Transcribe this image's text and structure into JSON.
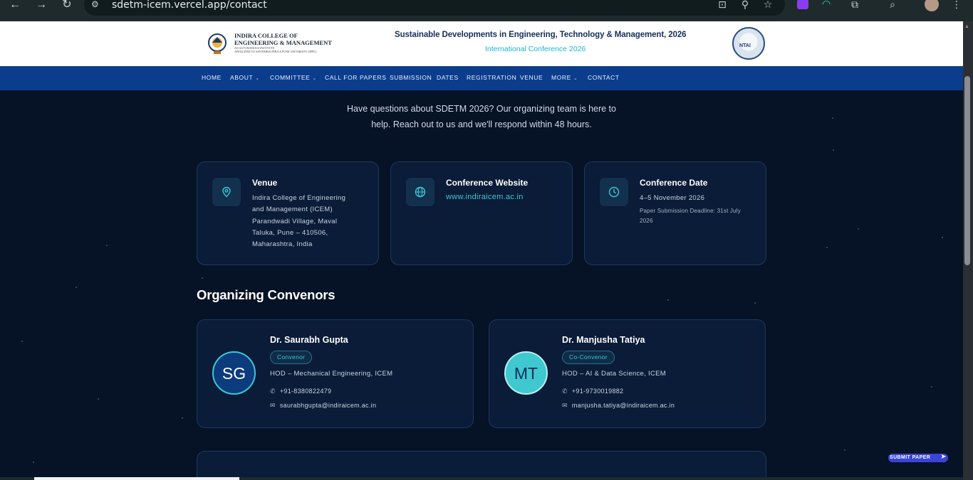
{
  "browser": {
    "url": "sdetm-icem.vercel.app/contact",
    "back_icon": "arrow-left-icon",
    "forward_icon": "arrow-right-icon",
    "reload_icon": "reload-icon"
  },
  "header": {
    "logo_line1": "INDIRA COLLEGE OF",
    "logo_line2": "ENGINEERING & MANAGEMENT",
    "logo_line3": "AN AUTONOMOUS INSTITUTE",
    "logo_line4": "AFFILIATED TO SAVITRIBAI PHULE PUNE UNIVERSITY (SPPU)",
    "logo_sub": "INDIRA",
    "conference_title": "Sustainable Developments in Engineering, Technology & Management, 2026",
    "conference_subtitle": "International Conference 2026",
    "badge_text": "NTAI"
  },
  "nav": {
    "items": [
      {
        "label": "HOME"
      },
      {
        "label": "ABOUT"
      },
      {
        "label": "COMMITTEE"
      },
      {
        "label": "CALL FOR PAPERS"
      },
      {
        "label": "SUBMISSION"
      },
      {
        "label": "DATES"
      },
      {
        "label": "REGISTRATION"
      },
      {
        "label": "VENUE"
      },
      {
        "label": "MORE"
      },
      {
        "label": "CONTACT"
      }
    ]
  },
  "intro": {
    "line1": "Have questions about SDETM 2026? Our organizing team is here to",
    "line2": "help. Reach out to us and we'll respond within 48 hours."
  },
  "info_cards": {
    "venue": {
      "title": "Venue",
      "line1": "Indira College of Engineering",
      "line2": "and Management (ICEM)",
      "line3": "Parandwadi Village, Maval",
      "line4": "Taluka, Pune – 410506,",
      "line5": "Maharashtra, India"
    },
    "website": {
      "title": "Conference Website",
      "link": "www.indiraicem.ac.in"
    },
    "date": {
      "title": "Conference Date",
      "value": "4–5 November 2026",
      "note": "Paper Submission Deadline: 31st July 2026"
    }
  },
  "convenors": {
    "section_title": "Organizing Convenors",
    "people": [
      {
        "initials": "SG",
        "name": "Dr. Saurabh Gupta",
        "role": "Convenor",
        "dept": "HOD – Mechanical Engineering, ICEM",
        "phone": "+91-8380822479",
        "email": "saurabhgupta@indiraicem.ac.in"
      },
      {
        "initials": "MT",
        "name": "Dr. Manjusha Tatiya",
        "role": "Co-Convenor",
        "dept": "HOD – AI & Data Science, ICEM",
        "phone": "+91-9730019882",
        "email": "manjusha.tatiya@indiraicem.ac.in"
      }
    ]
  },
  "floating": {
    "submit_label": "SUBMIT PAPER"
  },
  "colors": {
    "accent": "#3ec7d1",
    "nav": "#0b3d8c",
    "background": "#061225"
  }
}
